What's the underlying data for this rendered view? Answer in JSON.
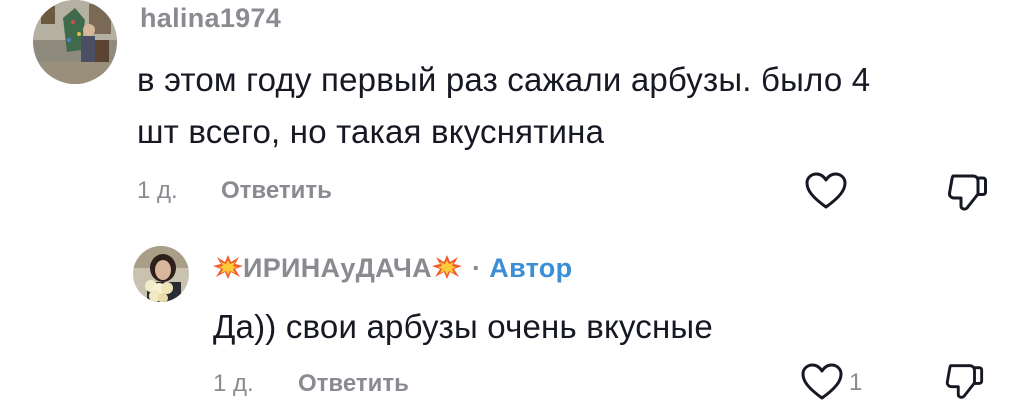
{
  "comments": [
    {
      "username": "halina1974",
      "text_line1": "в этом году первый раз сажали арбузы. было 4",
      "text_line2": "шт всего, но такая вкуснятина",
      "time": "1 д.",
      "reply_label": "Ответить",
      "avatar_icon": "avatar-photo"
    },
    {
      "username": "ИРИНАуДАЧА",
      "emoji_icon": "collision-emoji",
      "author_badge": "Автор",
      "separator": "·",
      "text": "Да)) свои арбузы очень вкусные",
      "time": "1 д.",
      "reply_label": "Ответить",
      "like_count": "1",
      "avatar_icon": "avatar-photo"
    }
  ],
  "icons": {
    "like": "heart-outline-icon",
    "dislike": "thumbs-down-outline-icon"
  },
  "colors": {
    "text_primary": "#161823",
    "text_secondary": "#8a8b91",
    "author_badge": "#3c8fd6"
  }
}
